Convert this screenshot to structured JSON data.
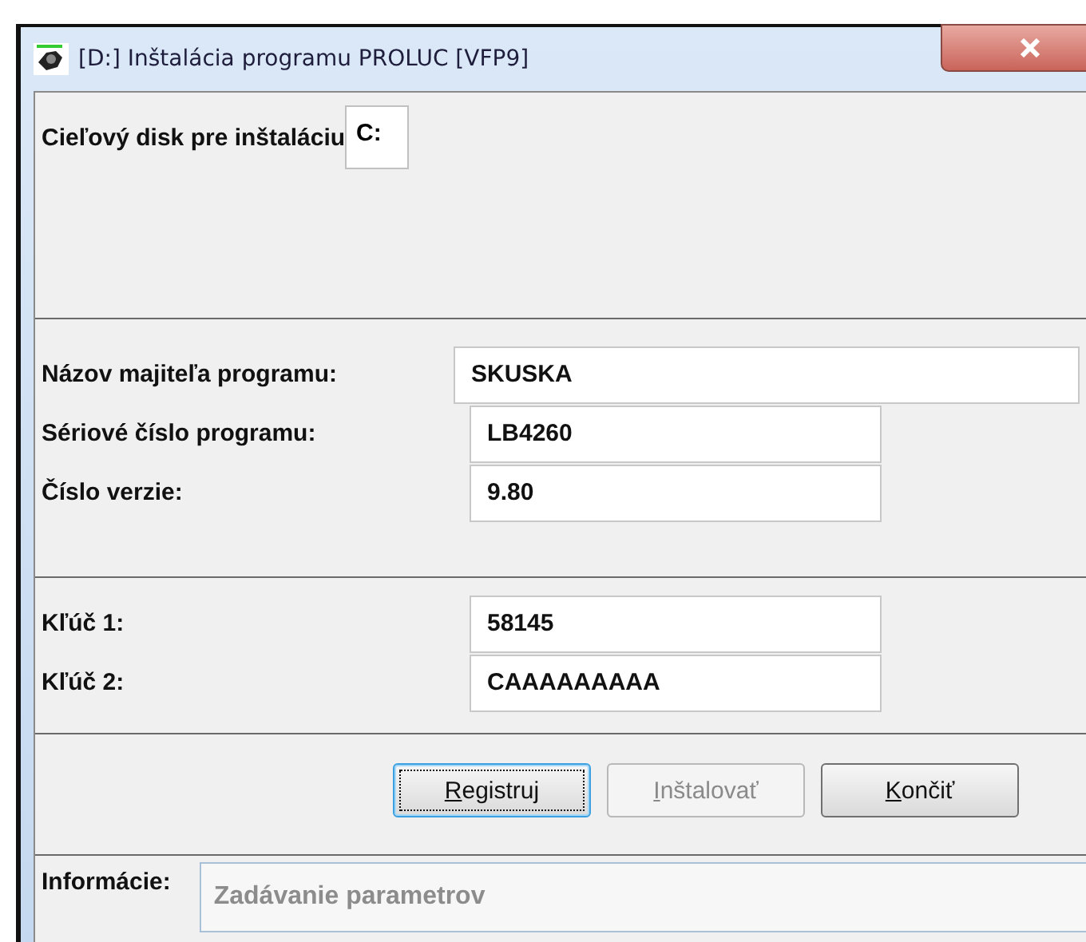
{
  "window": {
    "title": "[D:] Inštalácia programu PROLUC  [VFP9]"
  },
  "target": {
    "label": "Cieľový disk pre inštaláciu",
    "value": "C:"
  },
  "owner_fields": [
    {
      "label": "Názov majiteľa programu:",
      "value": "SKUSKA",
      "kind": "wide"
    },
    {
      "label": "Sériové číslo programu:",
      "value": "LB4260",
      "kind": "normal"
    },
    {
      "label": "Číslo verzie:",
      "value": "9.80",
      "kind": "normal"
    }
  ],
  "key_fields": [
    {
      "label": "Kľúč 1:",
      "value": "58145",
      "kind": "normal"
    },
    {
      "label": "Kľúč 2:",
      "value": "CAAAAAAAAA",
      "kind": "normal"
    }
  ],
  "buttons": [
    {
      "label": "Registruj",
      "focused": true,
      "disabled": false
    },
    {
      "label": "Inštalovať",
      "focused": false,
      "disabled": true
    },
    {
      "label": "Končiť",
      "focused": false,
      "disabled": false
    }
  ],
  "info": {
    "label": "Informácie:",
    "value": "Zadávanie parametrov",
    "disabled": true
  }
}
